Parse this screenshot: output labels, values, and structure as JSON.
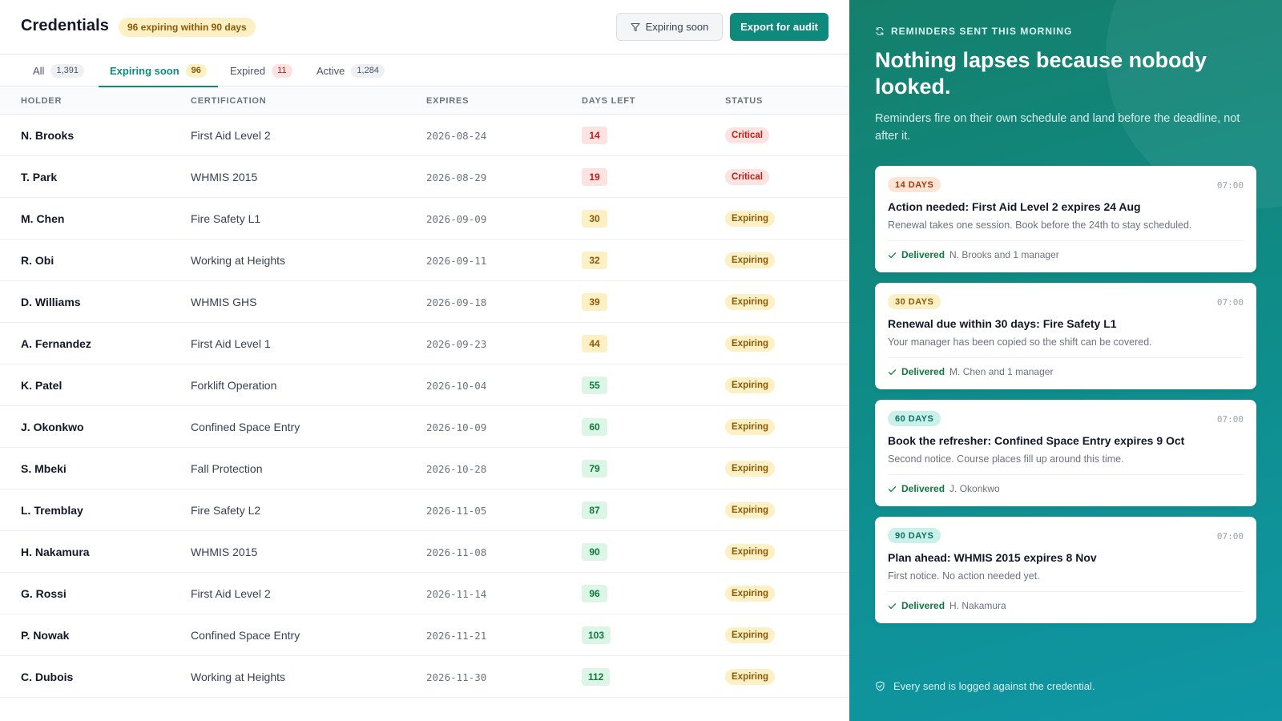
{
  "header": {
    "title": "Credentials",
    "badge": "96 expiring within 90 days",
    "filter_label": "Expiring soon",
    "export_label": "Export for audit"
  },
  "tabs": [
    {
      "label": "All",
      "count": "1,391"
    },
    {
      "label": "Expiring soon",
      "count": "96"
    },
    {
      "label": "Expired",
      "count": "11"
    },
    {
      "label": "Active",
      "count": "1,284"
    }
  ],
  "table": {
    "columns": [
      "HOLDER",
      "CERTIFICATION",
      "EXPIRES",
      "DAYS LEFT",
      "STATUS"
    ],
    "rows": [
      {
        "holder": "N. Brooks",
        "cert": "First Aid Level 2",
        "expires": "2026-08-24",
        "days": "14",
        "status": "Critical",
        "level": "red"
      },
      {
        "holder": "T. Park",
        "cert": "WHMIS 2015",
        "expires": "2026-08-29",
        "days": "19",
        "status": "Critical",
        "level": "red"
      },
      {
        "holder": "M. Chen",
        "cert": "Fire Safety L1",
        "expires": "2026-09-09",
        "days": "30",
        "status": "Expiring",
        "level": "yellow"
      },
      {
        "holder": "R. Obi",
        "cert": "Working at Heights",
        "expires": "2026-09-11",
        "days": "32",
        "status": "Expiring",
        "level": "yellow"
      },
      {
        "holder": "D. Williams",
        "cert": "WHMIS GHS",
        "expires": "2026-09-18",
        "days": "39",
        "status": "Expiring",
        "level": "yellow"
      },
      {
        "holder": "A. Fernandez",
        "cert": "First Aid Level 1",
        "expires": "2026-09-23",
        "days": "44",
        "status": "Expiring",
        "level": "yellow"
      },
      {
        "holder": "K. Patel",
        "cert": "Forklift Operation",
        "expires": "2026-10-04",
        "days": "55",
        "status": "Expiring",
        "level": "green"
      },
      {
        "holder": "J. Okonkwo",
        "cert": "Confined Space Entry",
        "expires": "2026-10-09",
        "days": "60",
        "status": "Expiring",
        "level": "green"
      },
      {
        "holder": "S. Mbeki",
        "cert": "Fall Protection",
        "expires": "2026-10-28",
        "days": "79",
        "status": "Expiring",
        "level": "green"
      },
      {
        "holder": "L. Tremblay",
        "cert": "Fire Safety L2",
        "expires": "2026-11-05",
        "days": "87",
        "status": "Expiring",
        "level": "green"
      },
      {
        "holder": "H. Nakamura",
        "cert": "WHMIS 2015",
        "expires": "2026-11-08",
        "days": "90",
        "status": "Expiring",
        "level": "green"
      },
      {
        "holder": "G. Rossi",
        "cert": "First Aid Level 2",
        "expires": "2026-11-14",
        "days": "96",
        "status": "Expiring",
        "level": "green"
      },
      {
        "holder": "P. Nowak",
        "cert": "Confined Space Entry",
        "expires": "2026-11-21",
        "days": "103",
        "status": "Expiring",
        "level": "green"
      },
      {
        "holder": "C. Dubois",
        "cert": "Working at Heights",
        "expires": "2026-11-30",
        "days": "112",
        "status": "Expiring",
        "level": "green"
      }
    ]
  },
  "panel": {
    "eyebrow": "REMINDERS SENT THIS MORNING",
    "headline": "Nothing lapses because nobody looked.",
    "subtext": "Reminders fire on their own schedule and land before the deadline, not after it.",
    "cards": [
      {
        "tag": "14 DAYS",
        "tone": "red",
        "time": "07:00",
        "title": "Action needed: First Aid Level 2 expires 24 Aug",
        "body": "Renewal takes one session. Book before the 24th to stay scheduled.",
        "status": "Delivered",
        "recipients": "N. Brooks and 1 manager"
      },
      {
        "tag": "30 DAYS",
        "tone": "yellow",
        "time": "07:00",
        "title": "Renewal due within 30 days: Fire Safety L1",
        "body": "Your manager has been copied so the shift can be covered.",
        "status": "Delivered",
        "recipients": "M. Chen and 1 manager"
      },
      {
        "tag": "60 DAYS",
        "tone": "teal",
        "time": "07:00",
        "title": "Book the refresher: Confined Space Entry expires 9 Oct",
        "body": "Second notice. Course places fill up around this time.",
        "status": "Delivered",
        "recipients": "J. Okonkwo"
      },
      {
        "tag": "90 DAYS",
        "tone": "teal",
        "time": "07:00",
        "title": "Plan ahead: WHMIS 2015 expires 8 Nov",
        "body": "First notice. No action needed yet.",
        "status": "Delivered",
        "recipients": "H. Nakamura"
      }
    ],
    "footer": "Every send is logged against the credential."
  }
}
